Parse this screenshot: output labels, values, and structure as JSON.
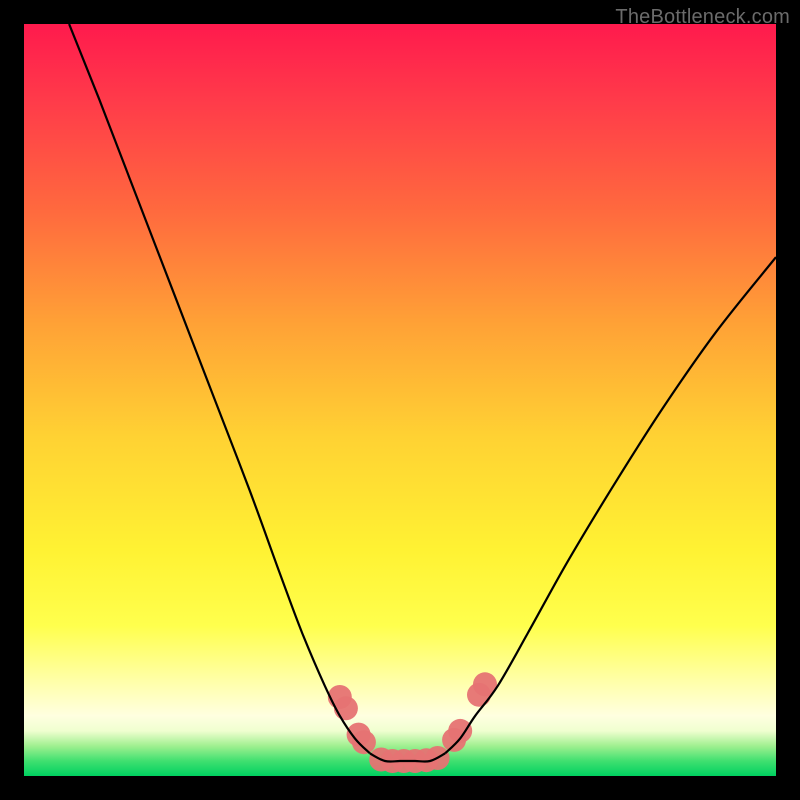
{
  "watermark": "TheBottleneck.com",
  "chart_data": {
    "type": "line",
    "title": "",
    "xlabel": "",
    "ylabel": "",
    "xlim": [
      0,
      100
    ],
    "ylim": [
      0,
      100
    ],
    "grid": false,
    "legend": false,
    "annotations": [],
    "series": [
      {
        "name": "left-branch",
        "x": [
          6,
          10,
          15,
          20,
          25,
          30,
          34,
          37,
          40,
          42,
          44,
          46
        ],
        "y": [
          100,
          90,
          77,
          64,
          51,
          38,
          27,
          19,
          12,
          8,
          5,
          3
        ]
      },
      {
        "name": "right-branch",
        "x": [
          56,
          58,
          60,
          63,
          67,
          72,
          78,
          85,
          92,
          100
        ],
        "y": [
          3,
          5,
          8,
          12,
          19,
          28,
          38,
          49,
          59,
          69
        ]
      },
      {
        "name": "bottom-flat",
        "x": [
          46,
          48,
          50,
          52,
          54,
          56
        ],
        "y": [
          3,
          2,
          2,
          2,
          2,
          3
        ]
      }
    ],
    "markers": [
      {
        "name": "marker-left-upper-1",
        "x": 42.0,
        "y": 10.5
      },
      {
        "name": "marker-left-upper-2",
        "x": 42.8,
        "y": 9.0
      },
      {
        "name": "marker-left-lower-1",
        "x": 44.5,
        "y": 5.5
      },
      {
        "name": "marker-left-lower-2",
        "x": 45.2,
        "y": 4.5
      },
      {
        "name": "marker-bottom-1",
        "x": 47.5,
        "y": 2.2
      },
      {
        "name": "marker-bottom-2",
        "x": 49.0,
        "y": 2.0
      },
      {
        "name": "marker-bottom-3",
        "x": 50.5,
        "y": 2.0
      },
      {
        "name": "marker-bottom-4",
        "x": 52.0,
        "y": 2.0
      },
      {
        "name": "marker-bottom-5",
        "x": 53.5,
        "y": 2.1
      },
      {
        "name": "marker-bottom-6",
        "x": 55.0,
        "y": 2.4
      },
      {
        "name": "marker-right-lower-1",
        "x": 57.2,
        "y": 4.8
      },
      {
        "name": "marker-right-lower-2",
        "x": 58.0,
        "y": 6.0
      },
      {
        "name": "marker-right-upper-1",
        "x": 60.5,
        "y": 10.8
      },
      {
        "name": "marker-right-upper-2",
        "x": 61.3,
        "y": 12.2
      }
    ],
    "marker_color": "#e67373",
    "marker_radius_pct": 1.6,
    "line_color": "#000000",
    "line_width": 2.2
  }
}
